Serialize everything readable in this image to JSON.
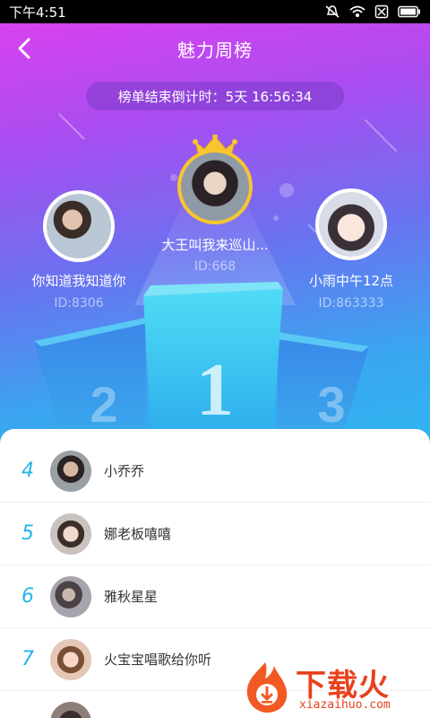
{
  "status_bar": {
    "time": "下午4:51",
    "icons": [
      "mute-icon",
      "wifi-icon",
      "no-sim-icon",
      "battery-icon"
    ]
  },
  "header": {
    "title": "魅力周榜",
    "back_icon": "back-arrow-icon"
  },
  "countdown": {
    "text": "榜单结束倒计时：5天 16:56:34"
  },
  "top_three": [
    {
      "rank": "1",
      "name": "大王叫我来巡山...",
      "id": "ID:668",
      "crown": "crown-icon"
    },
    {
      "rank": "2",
      "name": "你知道我知道你",
      "id": "ID:8306"
    },
    {
      "rank": "3",
      "name": "小雨中午12点",
      "id": "ID:863333"
    }
  ],
  "podium_labels": [
    "1",
    "2",
    "3"
  ],
  "ranking_list": [
    {
      "rank": "4",
      "name": "小乔乔"
    },
    {
      "rank": "5",
      "name": "娜老板嘻嘻"
    },
    {
      "rank": "6",
      "name": "雅秋星星"
    },
    {
      "rank": "7",
      "name": "火宝宝唱歌给你听"
    }
  ],
  "watermark": {
    "brand": "下载火",
    "url": "xiazaihuo.com"
  },
  "colors": {
    "accent": "#23b5e8",
    "gradient_top": "#e240f0",
    "gradient_bottom": "#2fb6f0",
    "crown": "#f7c531",
    "watermark": "#e8421c"
  }
}
